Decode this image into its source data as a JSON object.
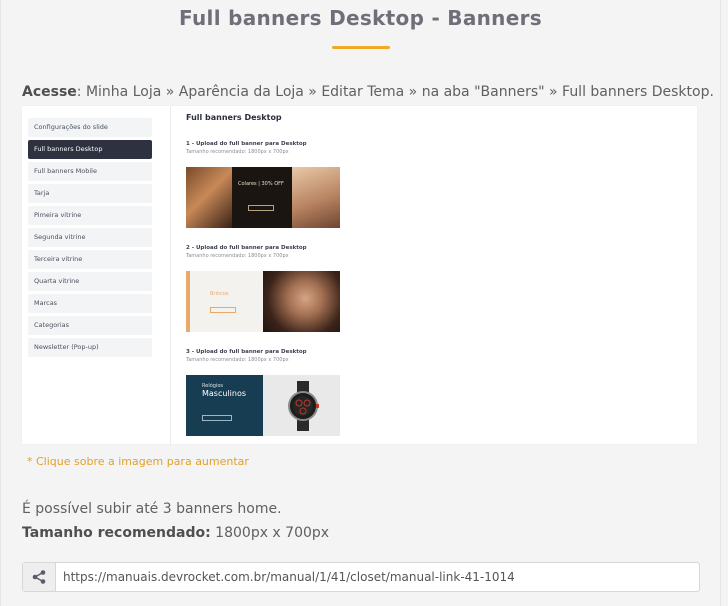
{
  "page": {
    "title": "Full banners Desktop - Banners",
    "access_label": "Acesse",
    "access_path": ": Minha Loja » Aparência da Loja » Editar Tema » na aba \"Banners\" » Full banners Desktop.",
    "accent_color": "#f2a825"
  },
  "screenshot": {
    "sidebar": [
      {
        "label": "Configurações do slide",
        "active": false
      },
      {
        "label": "Full banners Desktop",
        "active": true
      },
      {
        "label": "Full banners Mobile",
        "active": false
      },
      {
        "label": "Tarja",
        "active": false
      },
      {
        "label": "Pimeira vitrine",
        "active": false
      },
      {
        "label": "Segunda vitrine",
        "active": false
      },
      {
        "label": "Terceira vitrine",
        "active": false
      },
      {
        "label": "Quarta vitrine",
        "active": false
      },
      {
        "label": "Marcas",
        "active": false
      },
      {
        "label": "Categorias",
        "active": false
      },
      {
        "label": "Newsletter (Pop-up)",
        "active": false
      }
    ],
    "content_title": "Full banners Desktop",
    "uploads": [
      {
        "label": "1 - Upload do full banner para Desktop",
        "size": "Tamanho recomendado: 1800px x 700px"
      },
      {
        "label": "2 - Upload do full banner para Desktop",
        "size": "Tamanho recomendado: 1800px x 700px"
      },
      {
        "label": "3 - Upload do full banner para Desktop",
        "size": "Tamanho recomendado: 1800px x 700px"
      }
    ],
    "banner1": {
      "headline": "Colares | 30% OFF"
    },
    "banner2": {
      "headline": "Brincos"
    },
    "banner3": {
      "line1": "Relógios",
      "line2": "Masculinos"
    }
  },
  "hint": "* Clique sobre a imagem para aumentar",
  "info": {
    "line1": "É possível subir até 3 banners home.",
    "size_label": "Tamanho recomendado:",
    "size_value": " 1800px x 700px"
  },
  "share": {
    "icon": "share-icon",
    "url": "https://manuais.devrocket.com.br/manual/1/41/closet/manual-link-41-1014"
  }
}
